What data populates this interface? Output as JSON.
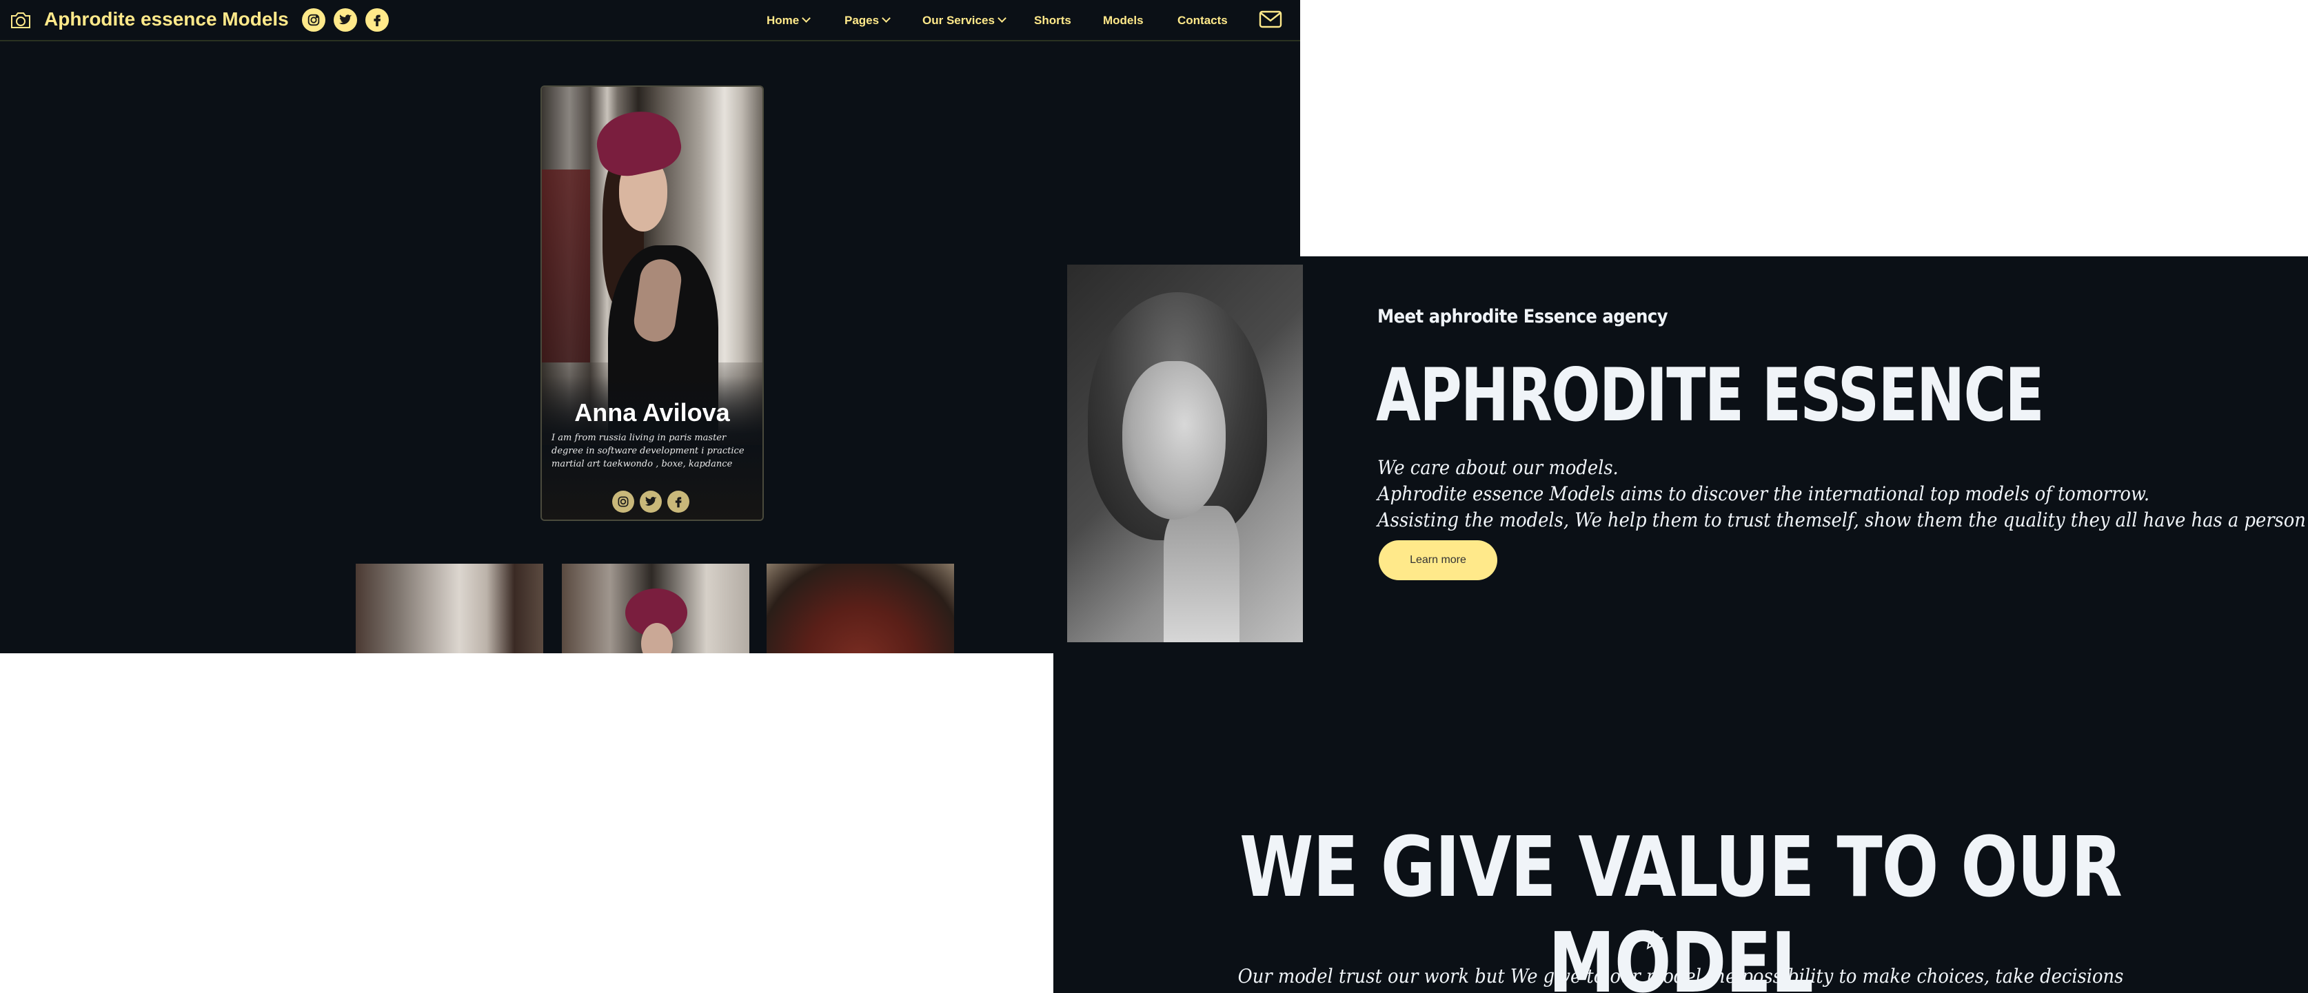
{
  "header": {
    "brand": "Aphrodite essence Models",
    "brand_icon": "camera-icon",
    "social": [
      "instagram-icon",
      "twitter-icon",
      "facebook-icon"
    ],
    "nav": [
      {
        "label": "Home",
        "dropdown": true
      },
      {
        "label": "Pages",
        "dropdown": true
      },
      {
        "label": "Our Services",
        "dropdown": true
      },
      {
        "label": "Shorts",
        "dropdown": false
      },
      {
        "label": "Models",
        "dropdown": false
      },
      {
        "label": "Contacts",
        "dropdown": false
      }
    ],
    "mail_icon": "mail-icon"
  },
  "profile": {
    "name": "Anna Avilova",
    "bio": "I am from russia living in paris master degree in software development i practice martial art taekwondo , boxe, kapdance",
    "social": [
      "instagram-icon",
      "twitter-icon",
      "facebook-icon"
    ]
  },
  "about": {
    "eyebrow": "Meet aphrodite Essence agency",
    "title": "APHRODITE ESSENCE",
    "lines": [
      "We care about our models.",
      "Aphrodite essence Models aims to discover the international top models of tomorrow.",
      "Assisting the models, We help them to trust themself, show them the quality they all have has a person as an artist"
    ],
    "cta": "Learn more"
  },
  "values": {
    "title": "WE GIVE VALUE TO OUR MODEL",
    "icon": "star-icon",
    "subtitle": "Our model trust our work but We give to our model the possibility to make choices, take decisions"
  },
  "colors": {
    "background": "#0b1016",
    "accent": "#ffe98a",
    "text": "#f0f4f8"
  }
}
